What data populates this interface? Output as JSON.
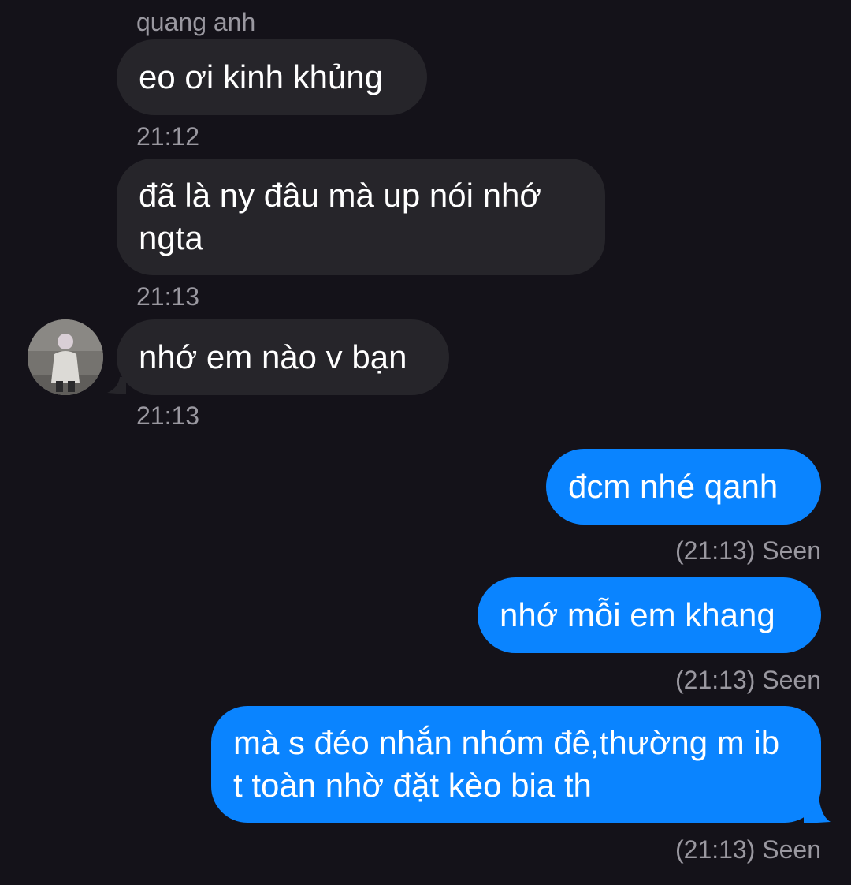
{
  "conversation": {
    "sender_name": "quang anh",
    "messages": [
      {
        "direction": "incoming",
        "text": "eo ơi kinh khủng",
        "time": "21:12"
      },
      {
        "direction": "incoming",
        "text": "đã là ny đâu mà up nói nhớ ngta",
        "time": "21:13"
      },
      {
        "direction": "incoming",
        "text": "nhớ em nào v bạn",
        "time": "21:13"
      },
      {
        "direction": "outgoing",
        "text": "đcm nhé qanh",
        "status": "(21:13) Seen"
      },
      {
        "direction": "outgoing",
        "text": "nhớ mỗi em khang",
        "status": "(21:13) Seen"
      },
      {
        "direction": "outgoing",
        "text": "mà s đéo nhắn nhóm đê,thường m ib t toàn nhờ đặt kèo bia th",
        "status": "(21:13) Seen"
      }
    ]
  },
  "colors": {
    "background": "#141219",
    "incoming_bubble": "#26252a",
    "outgoing_bubble": "#0a84ff",
    "meta_text": "#9a98a0"
  },
  "icons": {
    "avatar": "contact-avatar-photo"
  }
}
